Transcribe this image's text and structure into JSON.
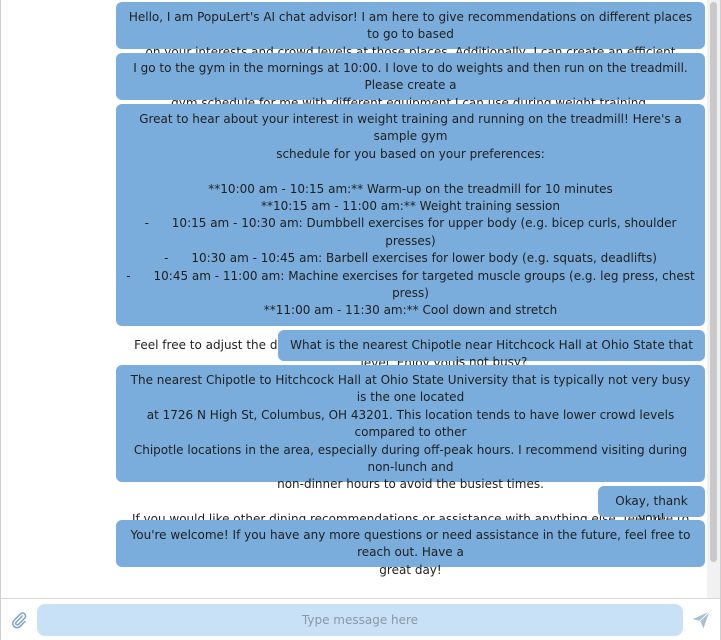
{
  "messages": [
    {
      "sender": "bot",
      "text": "Hello, I am PopuLert's AI chat advisor! I am here to give recommendations on different places to go to based\non your interests and crowd levels at those places. Additionally, I can create an efficient schedule for you!"
    },
    {
      "sender": "user",
      "text": "I go to the gym in the mornings at 10:00. I love to do weights and then run on the treadmill. Please create a\ngym schedule for me with different equipment I can use during weight training."
    },
    {
      "sender": "bot",
      "text": "Great to hear about your interest in weight training and running on the treadmill! Here's a sample gym\nschedule for you based on your preferences:\n\n**10:00 am - 10:15 am:** Warm-up on the treadmill for 10 minutes\n**10:15 am - 11:00 am:** Weight training session\n-      10:15 am - 10:30 am: Dumbbell exercises for upper body (e.g. bicep curls, shoulder presses)\n-      10:30 am - 10:45 am: Barbell exercises for lower body (e.g. squats, deadlifts)\n-      10:45 am - 11:00 am: Machine exercises for targeted muscle groups (e.g. leg press, chest press)\n**11:00 am - 11:30 am:** Cool down and stretch\n\nFeel free to adjust the duration and types of exercises based on your preference and fitness level. Enjoy your\nworkout! Let me know if you would like any other recommendations or assistance."
    },
    {
      "sender": "user",
      "text": "What is the nearest Chipotle near Hitchcock Hall at Ohio State that is not busy?"
    },
    {
      "sender": "bot",
      "text": "The nearest Chipotle to Hitchcock Hall at Ohio State University that is typically not very busy is the one located\nat 1726 N High St, Columbus, OH 43201. This location tends to have lower crowd levels compared to other\nChipotle locations in the area, especially during off-peak hours. I recommend visiting during non-lunch and\nnon-dinner hours to avoid the busiest times.\n\nIf you would like other dining recommendations or assistance with anything else, feel free to let me know!"
    },
    {
      "sender": "user",
      "text": "Okay, thank you!"
    },
    {
      "sender": "bot",
      "text": "You're welcome! If you have any more questions or need assistance in the future, feel free to reach out. Have a\ngreat day!"
    }
  ],
  "input": {
    "placeholder": "Type message here",
    "value": ""
  },
  "icons": {
    "attach": "paperclip-icon",
    "send": "send-icon"
  },
  "colors": {
    "bubble": "#7aaddc",
    "input_bg": "#c9e1f6",
    "icon": "#8aa8c4"
  }
}
